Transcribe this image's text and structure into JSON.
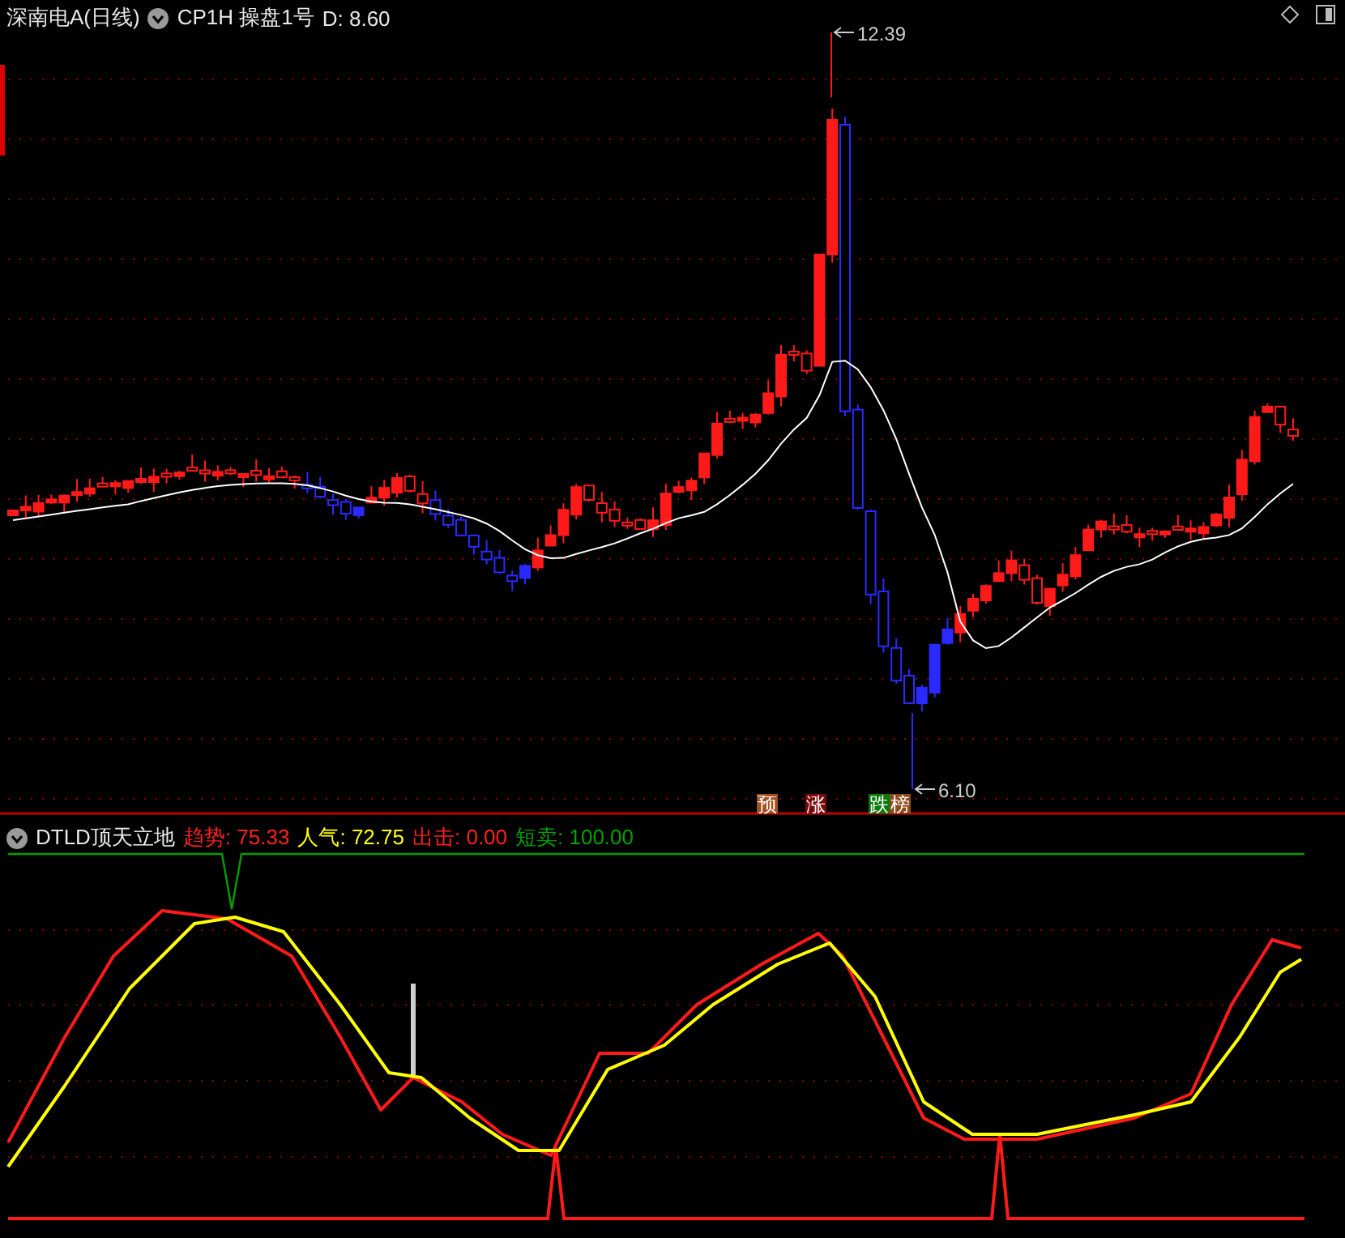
{
  "chart_header": {
    "title": "深南电A(日线)",
    "indicator": "CP1H 操盘1号",
    "reading": "D: 8.60"
  },
  "price_labels": [
    {
      "kind": "high",
      "text": "12.39"
    },
    {
      "kind": "low",
      "text": "6.10"
    }
  ],
  "signal_tags": [
    {
      "text": "预",
      "color": "#a0501a"
    },
    {
      "text": "涨",
      "color": "#7a0a0a"
    },
    {
      "text": "跌",
      "color": "#0a7a0a"
    },
    {
      "text": "榜",
      "color": "#8b4a1a"
    }
  ],
  "indicator_panel": {
    "name": "DTLD顶天立地",
    "readings": [
      {
        "text": "趋势: 75.33",
        "color": "#ff2020"
      },
      {
        "text": "人气: 72.75",
        "color": "#ffff00"
      },
      {
        "text": "出击: 0.00",
        "color": "#ff2020"
      },
      {
        "text": "短卖: 100.00",
        "color": "#00a000"
      }
    ]
  }
}
